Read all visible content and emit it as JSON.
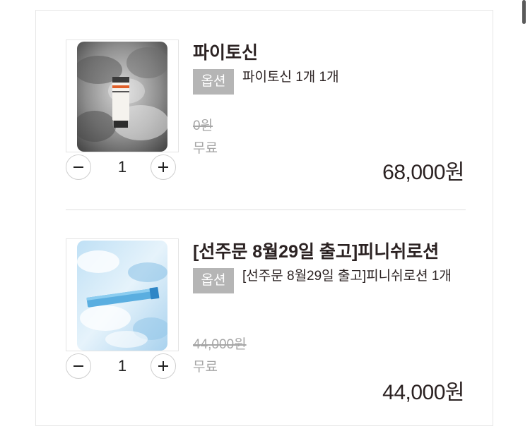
{
  "cart": {
    "items": [
      {
        "name": "파이토신",
        "option_badge": "옵션",
        "option_text": "파이토신 1개 1개",
        "original_price": "0원",
        "shipping": "무료",
        "price": "68,000원",
        "quantity": "1",
        "image_icon": "product-tube-dark"
      },
      {
        "name": "[선주문 8월29일 출고]피니쉬로션",
        "option_badge": "옵션",
        "option_text": "[선주문 8월29일 출고]피니쉬로션 1개",
        "original_price": "44,000원",
        "shipping": "무료",
        "price": "44,000원",
        "quantity": "1",
        "image_icon": "product-tube-blue"
      }
    ]
  },
  "colors": {
    "text": "#2b2222",
    "muted": "#a6a6a6",
    "badge": "#b5b5b5",
    "border": "#e6e6e6"
  }
}
